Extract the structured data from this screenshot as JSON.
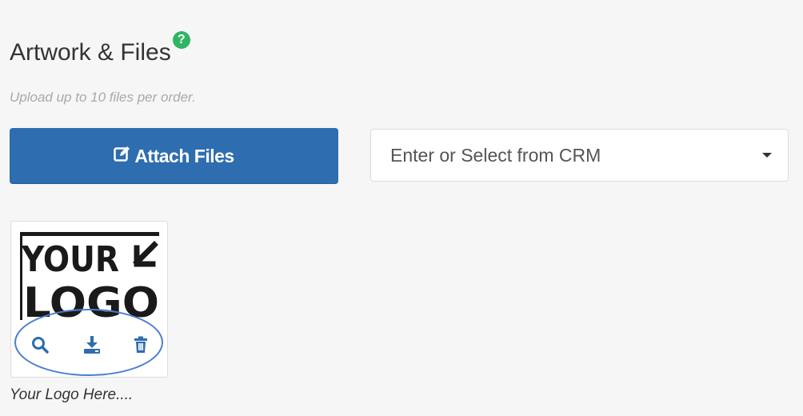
{
  "section": {
    "title": "Artwork & Files",
    "help_glyph": "?",
    "subtitle": "Upload up to 10 files per order."
  },
  "attach_button": {
    "label": "Attach Files",
    "icon": "edit-icon"
  },
  "crm_select": {
    "placeholder": "Enter or Select from CRM",
    "icon": "caret-down-icon"
  },
  "files": [
    {
      "image_text_top": "YOUR",
      "image_text_bottom": "LOGO",
      "name": "Your Logo Here....",
      "actions": [
        "search-icon",
        "download-icon",
        "trash-icon"
      ]
    }
  ],
  "colors": {
    "primary": "#2e6daf",
    "help": "#2fb463",
    "action_icon": "#2e6daf",
    "highlight": "#4a7ed0"
  }
}
